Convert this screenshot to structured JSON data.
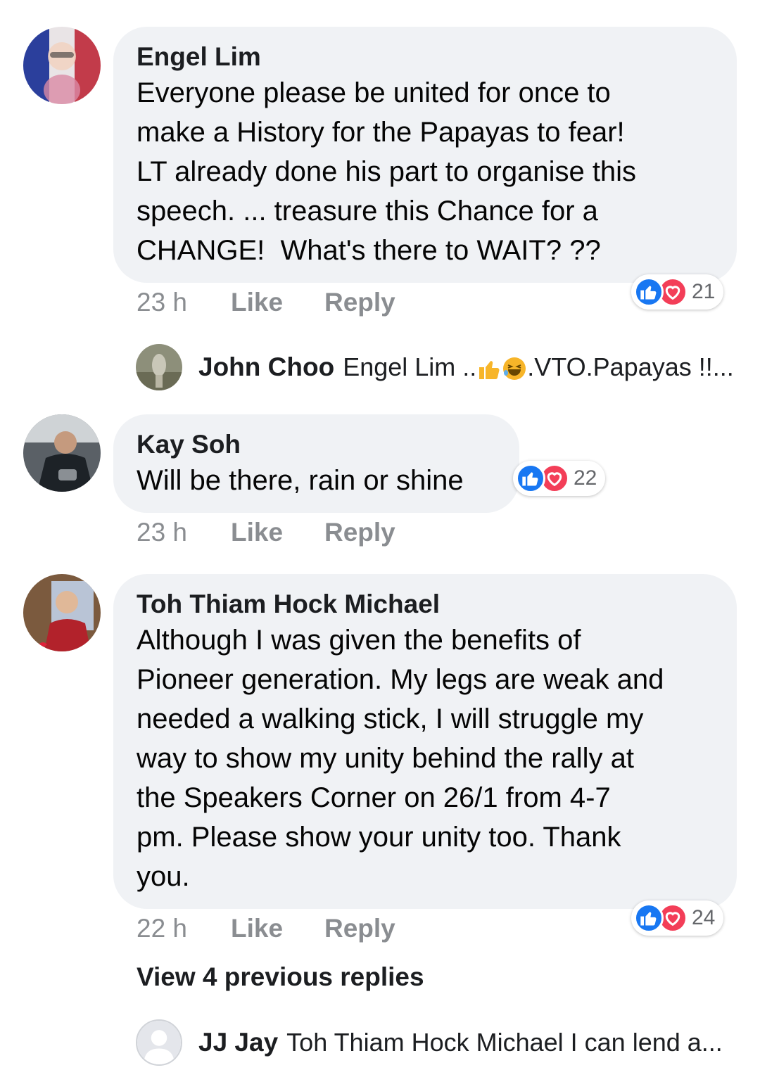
{
  "comments": [
    {
      "author": "Engel Lim",
      "text": "Everyone please be united for once to\nmake a History for the Papayas to fear!\nLT already done his part to organise this\nspeech. ... treasure this Chance for a\nCHANGE!  What's there to WAIT? ??",
      "time": "23 h",
      "like_label": "Like",
      "reply_label": "Reply",
      "reaction_count": "21",
      "reply_preview": {
        "author": "John Choo",
        "text_before": "Engel Lim ..",
        "text_after": ".VTO.Papayas !!..."
      }
    },
    {
      "author": "Kay Soh",
      "text": "Will be there, rain or shine",
      "time": "23 h",
      "like_label": "Like",
      "reply_label": "Reply",
      "reaction_count": "22"
    },
    {
      "author": "Toh Thiam Hock Michael",
      "text": "Although I was given the benefits of\nPioneer generation. My legs are weak and\nneeded a walking stick, I will struggle my\nway to show my unity behind the rally at\nthe Speakers Corner on 26/1 from 4-7\npm. Please show your unity too. Thank\nyou.",
      "time": "22 h",
      "like_label": "Like",
      "reply_label": "Reply",
      "reaction_count": "24",
      "view_previous": "View 4 previous replies",
      "reply_preview": {
        "author": "JJ Jay",
        "text": "Toh Thiam Hock Michael I can lend a..."
      }
    }
  ],
  "colors": {
    "bubble": "#f0f2f5",
    "meta": "#8a8d91",
    "like_blue": "#1877f2",
    "love_red": "#f33e58"
  }
}
